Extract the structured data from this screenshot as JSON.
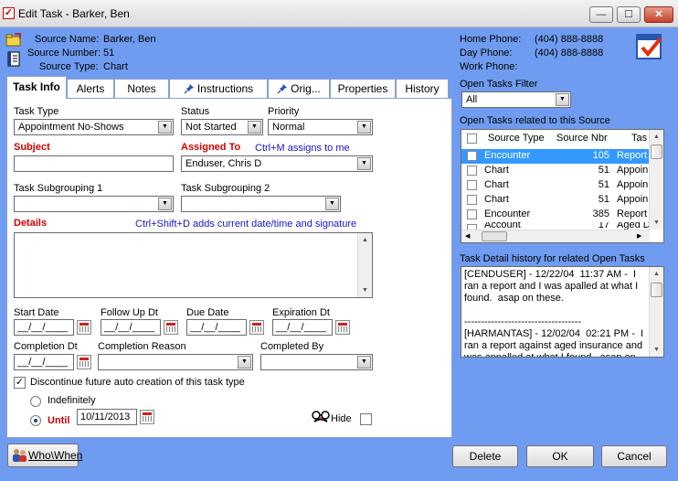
{
  "window": {
    "title": "Edit Task - Barker, Ben",
    "min_glyph": "—",
    "max_glyph": "☐",
    "close_glyph": "✕"
  },
  "source": {
    "name_label": "Source Name:",
    "name_value": "Barker, Ben",
    "number_label": "Source Number:",
    "number_value": "51",
    "type_label": "Source Type:",
    "type_value": "Chart"
  },
  "phones": {
    "home_label": "Home Phone:",
    "home_value": "(404) 888-8888",
    "day_label": "Day Phone:",
    "day_value": "(404) 888-8888",
    "work_label": "Work Phone:",
    "work_value": ""
  },
  "tabs": [
    {
      "label": "Task Info"
    },
    {
      "label": "Alerts"
    },
    {
      "label": "Notes"
    },
    {
      "label": "Instructions"
    },
    {
      "label": "Orig..."
    },
    {
      "label": "Properties"
    },
    {
      "label": "History"
    }
  ],
  "task_info": {
    "task_type_label": "Task Type",
    "task_type_value": "Appointment No-Shows",
    "status_label": "Status",
    "status_value": "Not Started",
    "priority_label": "Priority",
    "priority_value": "Normal",
    "subject_label": "Subject",
    "subject_value": "",
    "assigned_label": "Assigned To",
    "assigned_hint": "Ctrl+M assigns to me",
    "assigned_value": "Enduser, Chris D",
    "subgroup1_label": "Task Subgrouping 1",
    "subgroup1_value": "",
    "subgroup2_label": "Task Subgrouping 2",
    "subgroup2_value": "",
    "details_label": "Details",
    "details_hint": "Ctrl+Shift+D adds current date/time and signature",
    "details_value": "",
    "start_label": "Start Date",
    "start_value": "__/__/____",
    "followup_label": "Follow Up Dt",
    "followup_value": "__/__/____",
    "due_label": "Due Date",
    "due_value": "__/__/____",
    "expiration_label": "Expiration Dt",
    "expiration_value": "__/__/____",
    "completion_label": "Completion Dt",
    "completion_value": "__/__/____",
    "completion_reason_label": "Completion Reason",
    "completion_reason_value": "",
    "completed_by_label": "Completed By",
    "completed_by_value": "",
    "discontinue_label": "Discontinue future auto creation of this task type",
    "discontinue_checked": "✓",
    "indefinitely_label": "Indefinitely",
    "until_label": "Until",
    "until_value": "10/11/2013",
    "hide_label": "Hide"
  },
  "filter": {
    "label": "Open Tasks Filter",
    "value": "All"
  },
  "open_tasks": {
    "label": "Open Tasks related to this Source",
    "columns": [
      "Source Type",
      "Source Nbr",
      "Tas"
    ],
    "rows": [
      {
        "type": "Encounter",
        "nbr": "105",
        "task": "Report"
      },
      {
        "type": "Chart",
        "nbr": "51",
        "task": "Appoin"
      },
      {
        "type": "Chart",
        "nbr": "51",
        "task": "Appoin"
      },
      {
        "type": "Chart",
        "nbr": "51",
        "task": "Appoin"
      },
      {
        "type": "Encounter",
        "nbr": "385",
        "task": "Report"
      },
      {
        "type": "Account",
        "nbr": "17",
        "task": "Aged D"
      }
    ]
  },
  "history": {
    "label": "Task Detail history for related Open Tasks",
    "text": "[CENDUSER] - 12/22/04  11:37 AM -  I ran a report and I was apalled at what I found.  asap on these.\n\n-----------------------------------\n[HARMANTAS] - 12/02/04  02:21 PM -  I ran a report against aged insurance and was appalled at what I found.  asap on"
  },
  "footer": {
    "who_when_label": "Who\\When",
    "delete_label": "Delete",
    "ok_label": "OK",
    "cancel_label": "Cancel"
  },
  "colors": {
    "window_bg": "#6f9cf0",
    "required_label": "#d00000",
    "hint_text": "#1515c8",
    "selected_row": "#3399ff"
  }
}
